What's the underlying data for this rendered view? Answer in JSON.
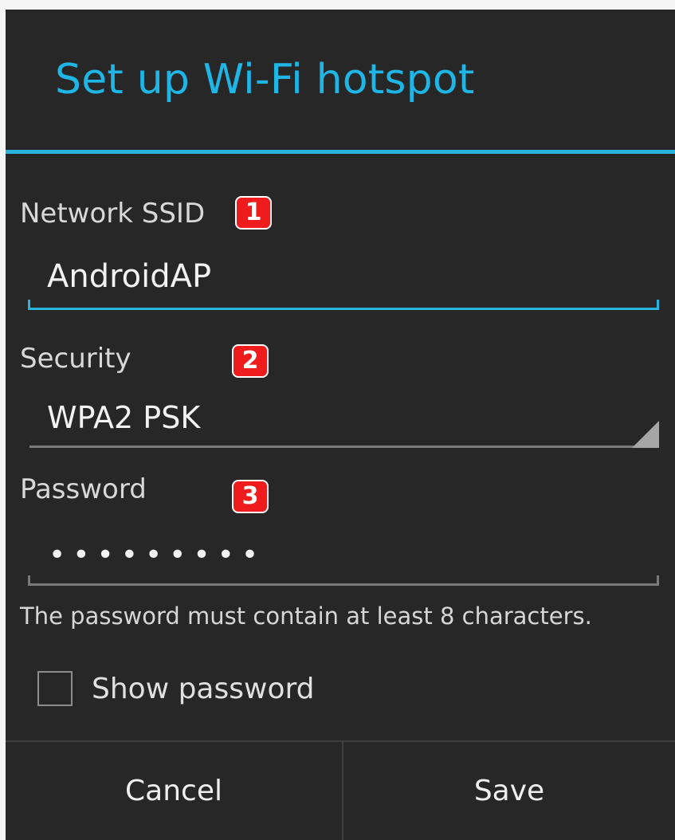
{
  "dialog": {
    "title": "Set up Wi-Fi hotspot",
    "accent_color": "#1fb6e6",
    "background_color": "#272727"
  },
  "ssid": {
    "label": "Network SSID",
    "badge": "1",
    "value": "AndroidAP"
  },
  "security": {
    "label": "Security",
    "badge": "2",
    "selected": "WPA2 PSK"
  },
  "password": {
    "label": "Password",
    "badge": "3",
    "masked_value": "•••••••••",
    "helper_text": "The password must contain at least 8 characters."
  },
  "show_password": {
    "label": "Show password",
    "checked": false
  },
  "buttons": {
    "cancel": "Cancel",
    "save": "Save"
  },
  "badge_color": "#ee1c1c"
}
